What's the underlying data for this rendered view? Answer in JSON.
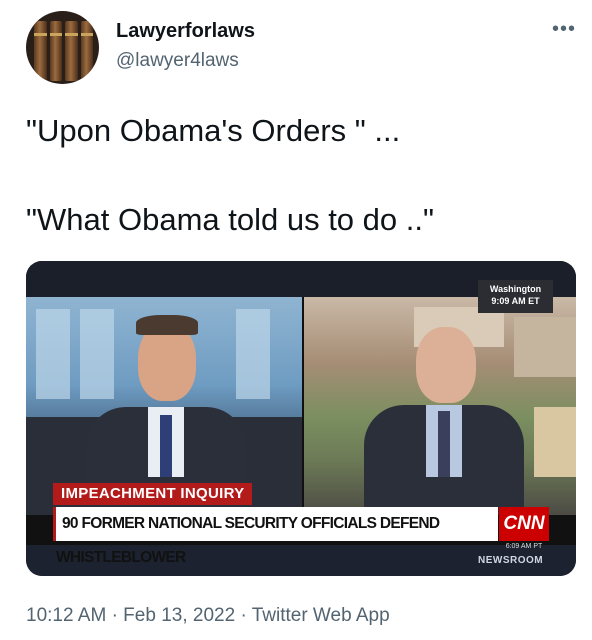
{
  "user": {
    "display_name": "Lawyerforlaws",
    "handle": "@lawyer4laws"
  },
  "tweet": {
    "line1": "\"Upon Obama's Orders \" ...",
    "line2": "\"What Obama told us to do ..\""
  },
  "media": {
    "location_label": "Washington",
    "location_time": "9:09 AM ET",
    "chyron_top": "IMPEACHMENT INQUIRY",
    "chyron_main": "90 FORMER NATIONAL SECURITY OFFICIALS DEFEND WHISTLEBLOWER",
    "network_logo": "CNN",
    "network_time": "6:09 AM PT",
    "program": "NEWSROOM"
  },
  "meta": {
    "time": "10:12 AM",
    "date": "Feb 13, 2022",
    "source": "Twitter Web App"
  },
  "icons": {
    "more": "more-dots-icon"
  }
}
